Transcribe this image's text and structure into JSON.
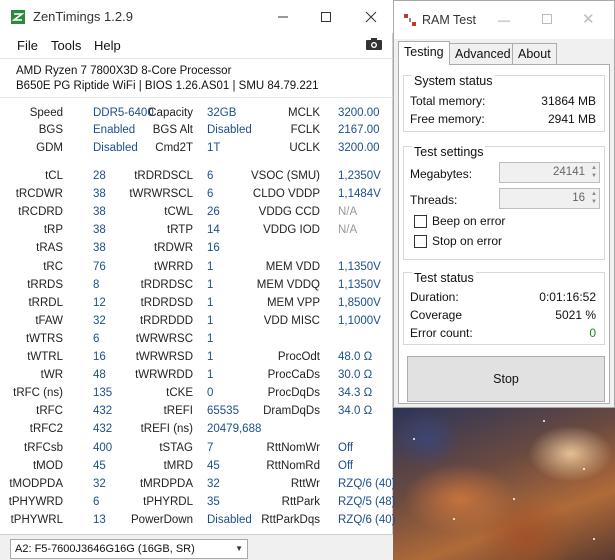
{
  "zentimings": {
    "title": "ZenTimings 1.2.9",
    "menu": [
      "File",
      "Tools",
      "Help"
    ],
    "cpu": "AMD Ryzen 7 7800X3D 8-Core Processor",
    "board": "B650E PG Riptide WiFi | BIOS 1.26.AS01 | SMU 84.79.221",
    "top": [
      [
        {
          "l": "Speed",
          "v": "DDR5-6400"
        },
        {
          "l": "Capacity",
          "v": "32GB"
        },
        {
          "l": "MCLK",
          "v": "3200.00"
        }
      ],
      [
        {
          "l": "BGS",
          "v": "Enabled"
        },
        {
          "l": "BGS Alt",
          "v": "Disabled"
        },
        {
          "l": "FCLK",
          "v": "2167.00"
        }
      ],
      [
        {
          "l": "GDM",
          "v": "Disabled"
        },
        {
          "l": "Cmd2T",
          "v": "1T"
        },
        {
          "l": "UCLK",
          "v": "3200.00"
        }
      ]
    ],
    "rows": [
      [
        {
          "l": "tCL",
          "v": "28"
        },
        {
          "l": "tRDRDSCL",
          "v": "6"
        },
        {
          "l": "VSOC (SMU)",
          "v": "1,2350V"
        }
      ],
      [
        {
          "l": "tRCDWR",
          "v": "38"
        },
        {
          "l": "tWRWRSCL",
          "v": "6"
        },
        {
          "l": "CLDO VDDP",
          "v": "1,1484V"
        }
      ],
      [
        {
          "l": "tRCDRD",
          "v": "38"
        },
        {
          "l": "tCWL",
          "v": "26"
        },
        {
          "l": "VDDG CCD",
          "v": "N/A",
          "dim": true
        }
      ],
      [
        {
          "l": "tRP",
          "v": "38"
        },
        {
          "l": "tRTP",
          "v": "14"
        },
        {
          "l": "VDDG IOD",
          "v": "N/A",
          "dim": true
        }
      ],
      [
        {
          "l": "tRAS",
          "v": "38"
        },
        {
          "l": "tRDWR",
          "v": "16"
        },
        {
          "l": "",
          "v": ""
        }
      ],
      [
        {
          "l": "tRC",
          "v": "76"
        },
        {
          "l": "tWRRD",
          "v": "1"
        },
        {
          "l": "MEM VDD",
          "v": "1,1350V"
        }
      ],
      [
        {
          "l": "tRRDS",
          "v": "8"
        },
        {
          "l": "tRDRDSC",
          "v": "1"
        },
        {
          "l": "MEM VDDQ",
          "v": "1,1350V"
        }
      ],
      [
        {
          "l": "tRRDL",
          "v": "12"
        },
        {
          "l": "tRDRDSD",
          "v": "1"
        },
        {
          "l": "MEM VPP",
          "v": "1,8500V"
        }
      ],
      [
        {
          "l": "tFAW",
          "v": "32"
        },
        {
          "l": "tRDRDDD",
          "v": "1"
        },
        {
          "l": "VDD MISC",
          "v": "1,1000V"
        }
      ],
      [
        {
          "l": "tWTRS",
          "v": "6"
        },
        {
          "l": "tWRWRSC",
          "v": "1"
        },
        {
          "l": "",
          "v": ""
        }
      ],
      [
        {
          "l": "tWTRL",
          "v": "16"
        },
        {
          "l": "tWRWRSD",
          "v": "1"
        },
        {
          "l": "ProcOdt",
          "v": "48.0 Ω"
        }
      ],
      [
        {
          "l": "tWR",
          "v": "48"
        },
        {
          "l": "tWRWRDD",
          "v": "1"
        },
        {
          "l": "ProcCaDs",
          "v": "30.0 Ω"
        }
      ],
      [
        {
          "l": "tRFC (ns)",
          "v": "135"
        },
        {
          "l": "tCKE",
          "v": "0"
        },
        {
          "l": "ProcDqDs",
          "v": "34.3 Ω"
        }
      ],
      [
        {
          "l": "tRFC",
          "v": "432"
        },
        {
          "l": "tREFI",
          "v": "65535"
        },
        {
          "l": "DramDqDs",
          "v": "34.0 Ω"
        }
      ],
      [
        {
          "l": "tRFC2",
          "v": "432"
        },
        {
          "l": "tREFI (ns)",
          "v": "20479,688"
        },
        {
          "l": "",
          "v": ""
        }
      ],
      [
        {
          "l": "tRFCsb",
          "v": "400"
        },
        {
          "l": "tSTAG",
          "v": "7"
        },
        {
          "l": "RttNomWr",
          "v": "Off"
        }
      ],
      [
        {
          "l": "tMOD",
          "v": "45"
        },
        {
          "l": "tMRD",
          "v": "45"
        },
        {
          "l": "RttNomRd",
          "v": "Off"
        }
      ],
      [
        {
          "l": "tMODPDA",
          "v": "32"
        },
        {
          "l": "tMRDPDA",
          "v": "32"
        },
        {
          "l": "RttWr",
          "v": "RZQ/6 (40)"
        }
      ],
      [
        {
          "l": "tPHYWRD",
          "v": "6"
        },
        {
          "l": "tPHYRDL",
          "v": "35"
        },
        {
          "l": "RttPark",
          "v": "RZQ/5 (48)"
        }
      ],
      [
        {
          "l": "tPHYWRL",
          "v": "13"
        },
        {
          "l": "PowerDown",
          "v": "Disabled"
        },
        {
          "l": "RttParkDqs",
          "v": "RZQ/6 (40)"
        }
      ]
    ],
    "dimm": "A2: F5-7600J3646G16G (16GB, SR)"
  },
  "ramtest": {
    "title": "RAM Test",
    "tabs": [
      "Testing",
      "Advanced",
      "About"
    ],
    "system_status": {
      "title": "System status",
      "total_label": "Total memory:",
      "total_value": "31864 MB",
      "free_label": "Free memory:",
      "free_value": "2941 MB"
    },
    "settings": {
      "title": "Test settings",
      "mb_label": "Megabytes:",
      "mb_value": "24141",
      "threads_label": "Threads:",
      "threads_value": "16",
      "beep_label": "Beep on error",
      "stop_label": "Stop on error"
    },
    "status": {
      "title": "Test status",
      "duration_label": "Duration:",
      "duration_value": "0:01:16:52",
      "coverage_label": "Coverage",
      "coverage_value": "5021 %",
      "errors_label": "Error count:",
      "errors_value": "0"
    },
    "stop_button": "Stop"
  },
  "colors": {
    "value_blue": "#1c4f8c",
    "error_green": "#1a8a1a"
  }
}
